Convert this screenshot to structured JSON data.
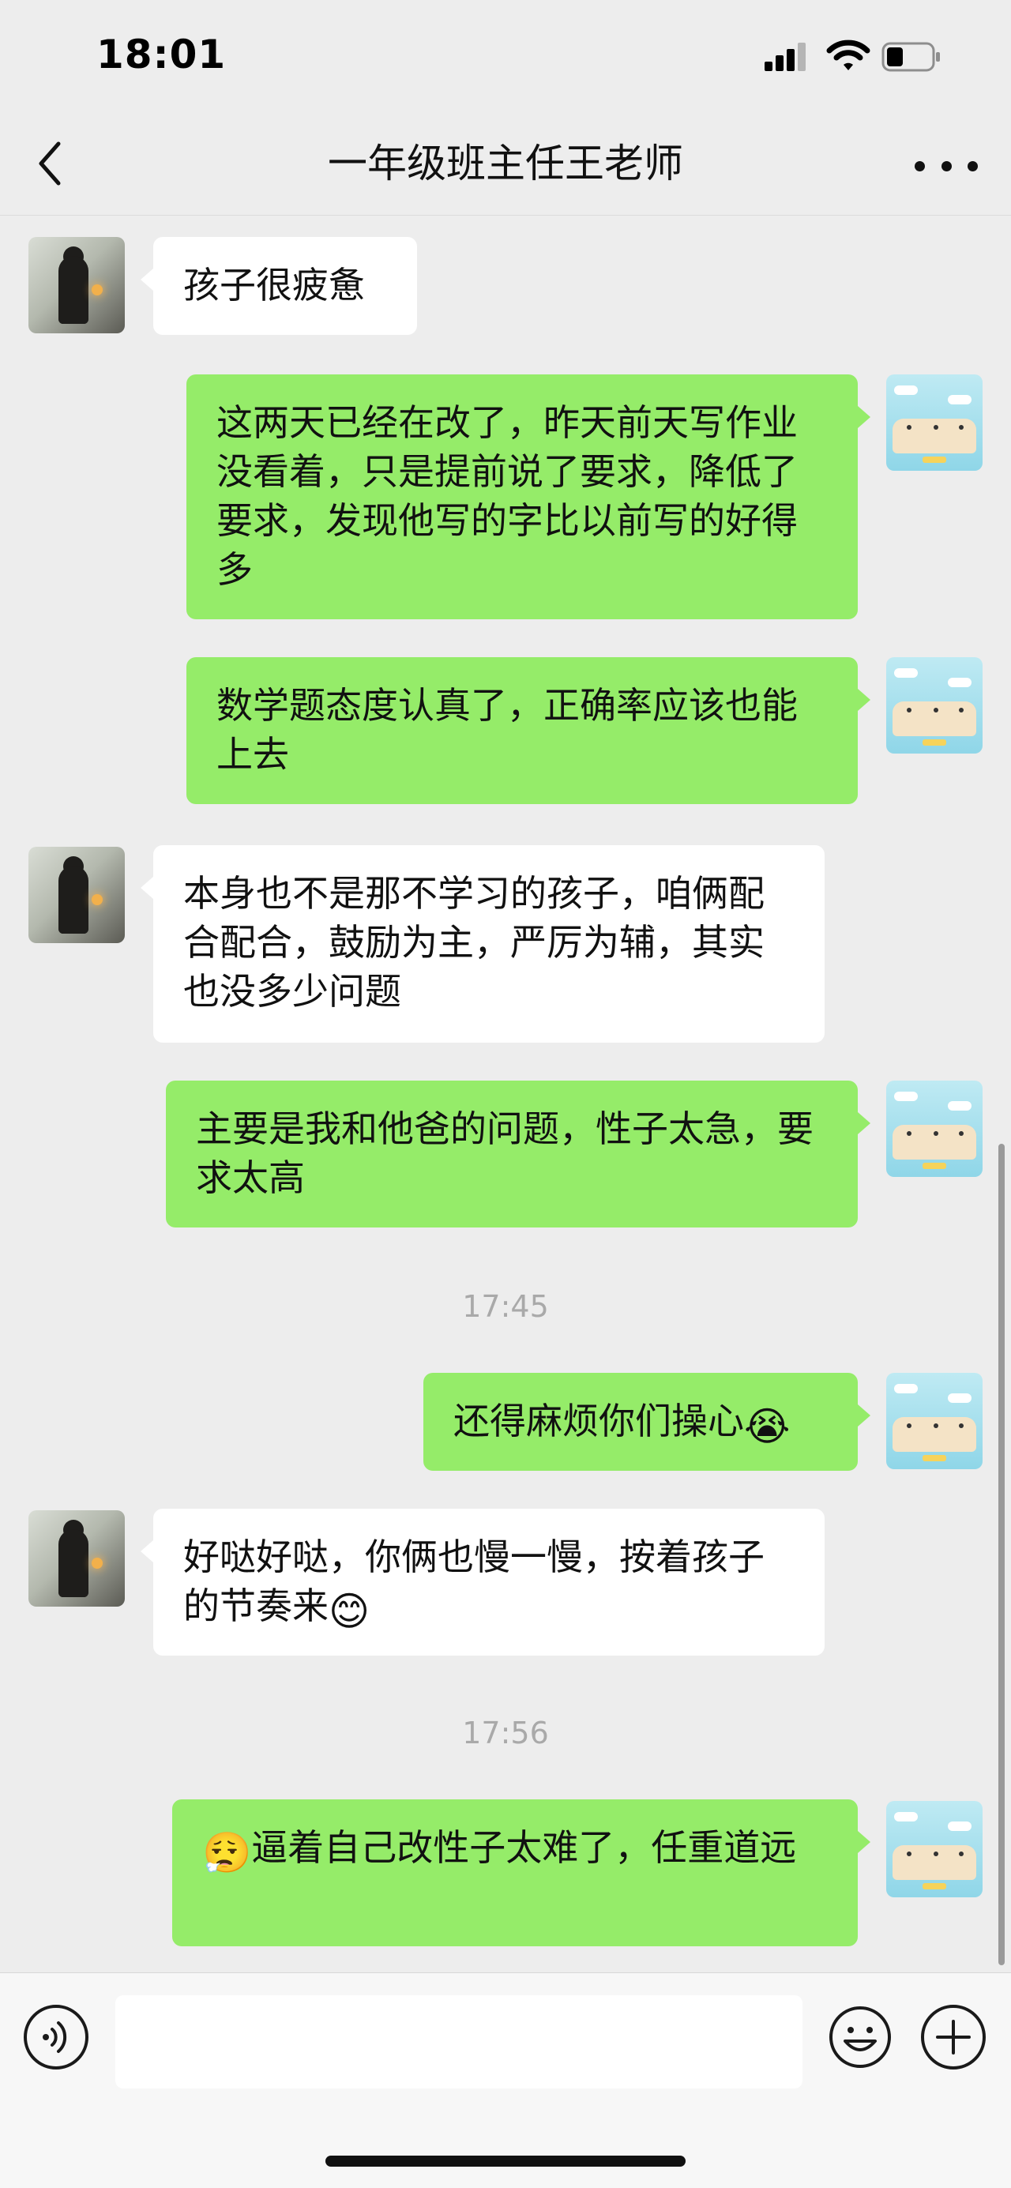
{
  "status_bar": {
    "time": "18:01"
  },
  "nav": {
    "title": "一年级班主任王老师"
  },
  "messages": [
    {
      "side": "in",
      "text": "孩子很疲惫"
    },
    {
      "side": "out",
      "text": "这两天已经在改了，昨天前天写作业没看着，只是提前说了要求，降低了要求，发现他写的字比以前写的好得多"
    },
    {
      "side": "out",
      "text": "数学题态度认真了，正确率应该也能上去"
    },
    {
      "side": "in",
      "text": "本身也不是那不学习的孩子，咱俩配合配合，鼓励为主，严厉为辅，其实也没多少问题"
    },
    {
      "side": "out",
      "text": "主要是我和他爸的问题，性子太急，要求太高"
    },
    {
      "side": "time",
      "text": "17:45"
    },
    {
      "side": "out",
      "text": "还得麻烦你们操心",
      "emoji_after": "😭"
    },
    {
      "side": "in",
      "text": "好哒好哒，你俩也慢一慢，按着孩子的节奏来",
      "emoji_after": "😊"
    },
    {
      "side": "time",
      "text": "17:56"
    },
    {
      "side": "out",
      "text": "逼着自己改性子太难了，任重道远",
      "emoji_before": "😮‍💨"
    }
  ],
  "icons": {
    "back": "chevron-left-icon",
    "more": "more-dots-icon",
    "voice": "voice-icon",
    "emoji": "smiley-icon",
    "plus": "plus-icon"
  },
  "colors": {
    "outgoing_bubble": "#95ec69",
    "incoming_bubble": "#ffffff",
    "background": "#ededed"
  }
}
